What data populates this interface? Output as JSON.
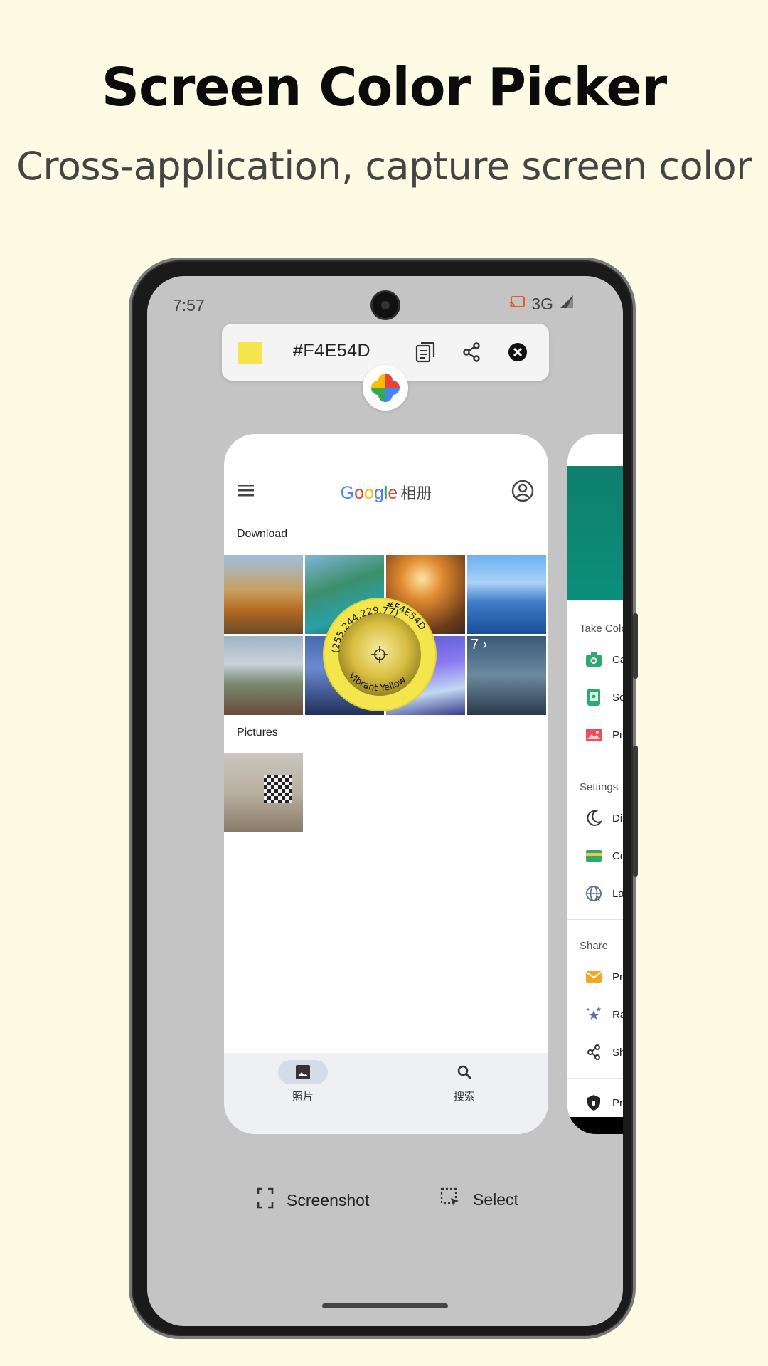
{
  "promo": {
    "title": "Screen Color Picker",
    "subtitle": "Cross-application, capture screen color"
  },
  "status_bar": {
    "time": "7:57",
    "network": "3G",
    "icons": [
      "cast-icon",
      "signal-icon"
    ]
  },
  "picker_bar": {
    "swatch_color": "#F4E54D",
    "hex_value": "#F4E54D",
    "icons": [
      "copy-icon",
      "share-icon",
      "close-icon"
    ]
  },
  "photos_app": {
    "brand": "Google",
    "title_suffix": "相册",
    "section_download": "Download",
    "section_pictures": "Pictures",
    "more_count": "7",
    "nav": [
      {
        "label": "照片",
        "icon": "photo-icon"
      },
      {
        "label": "搜索",
        "icon": "search-icon"
      }
    ]
  },
  "loupe": {
    "rgb": "(255,244,229,77)",
    "hex": "#F4E54D",
    "name": "Vibrant Yellow",
    "color": "#F4E54D"
  },
  "side_menu": {
    "take_color_header": "Take Colo",
    "settings_header": "Settings",
    "share_header": "Share",
    "take_color_items": [
      {
        "label": "Ca",
        "icon": "camera-icon",
        "color": "#2eaa6e"
      },
      {
        "label": "Sc",
        "icon": "screen-icon",
        "color": "#2eaa6e"
      },
      {
        "label": "Pi",
        "icon": "picture-icon",
        "color": "#ea4f5a"
      }
    ],
    "settings_items": [
      {
        "label": "Di",
        "icon": "moon-icon"
      },
      {
        "label": "Co",
        "icon": "card-icon",
        "color": "#2eaa6e"
      },
      {
        "label": "La",
        "icon": "language-icon"
      }
    ],
    "share_items": [
      {
        "label": "Pr",
        "icon": "mail-icon",
        "color": "#f5a623"
      },
      {
        "label": "Ra",
        "icon": "stars-icon",
        "color": "#5a6fa8"
      },
      {
        "label": "Sh",
        "icon": "share-icon"
      },
      {
        "label": "Pr",
        "icon": "privacy-icon"
      }
    ]
  },
  "bottom_actions": {
    "screenshot": "Screenshot",
    "select": "Select"
  },
  "colors": {
    "background": "#FEFBE5",
    "screen": "#C4C4C4",
    "accent_yellow": "#F4E54D",
    "teal": "#0f7f6e"
  }
}
